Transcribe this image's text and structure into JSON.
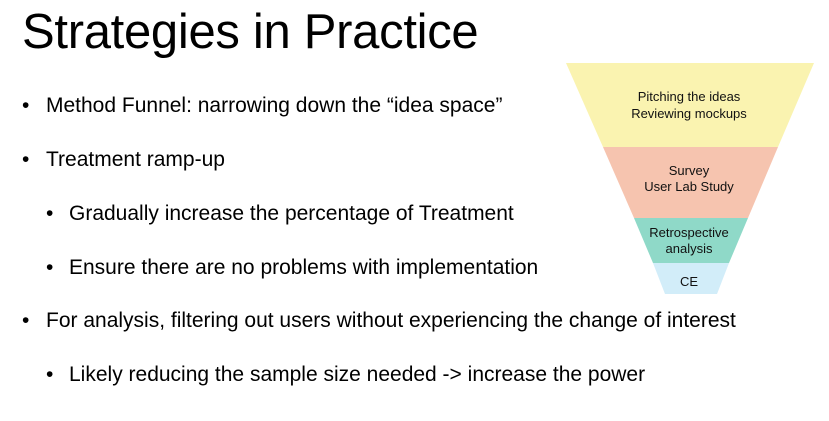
{
  "slide": {
    "title": "Strategies in Practice",
    "bullet_glyph": "•",
    "bullets": [
      {
        "level": 1,
        "text": "Method Funnel: narrowing down the “idea space”"
      },
      {
        "level": 1,
        "text": "Treatment ramp-up"
      },
      {
        "level": 2,
        "text": "Gradually increase the percentage of Treatment"
      },
      {
        "level": 2,
        "text": "Ensure there are no problems with implementation"
      },
      {
        "level": 1,
        "text": "For analysis, filtering out users without experiencing the change of interest"
      },
      {
        "level": 2,
        "text": "Likely reducing the sample size needed -> increase the power"
      }
    ]
  },
  "funnel": {
    "tiers": [
      {
        "lines": [
          "Pitching the ideas",
          "Reviewing mockups"
        ],
        "color": "#faf3b0"
      },
      {
        "lines": [
          "Survey",
          "User Lab Study"
        ],
        "color": "#f6c4af"
      },
      {
        "lines": [
          "Retrospective",
          "analysis"
        ],
        "color": "#8fd9c8"
      },
      {
        "lines": [
          "CE"
        ],
        "color": "#d2edf9"
      }
    ]
  }
}
